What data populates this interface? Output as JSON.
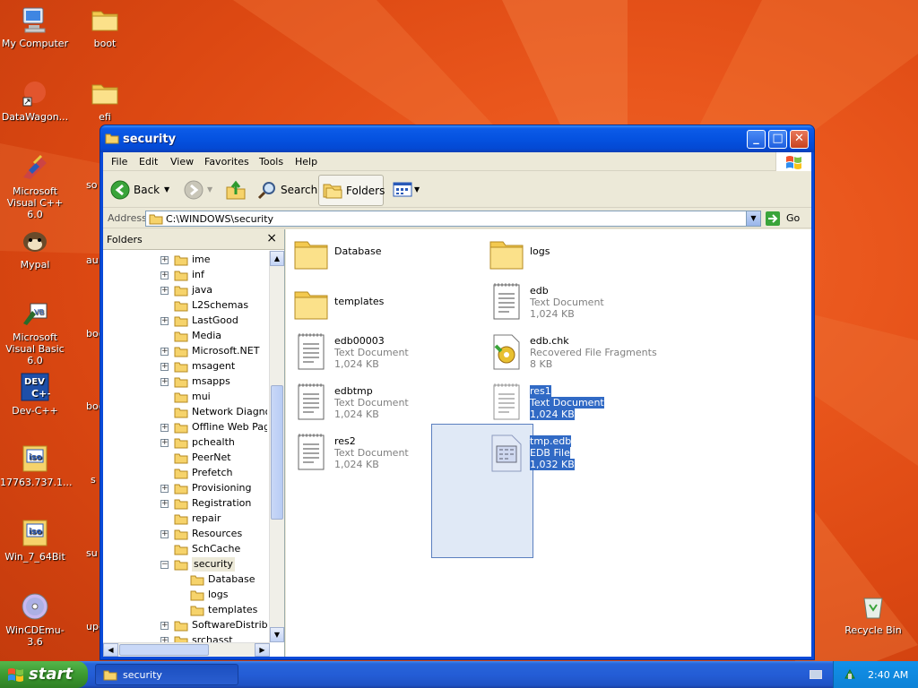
{
  "desktop": {
    "icons": [
      {
        "label": "My Computer",
        "icon": "my-computer-icon"
      },
      {
        "label": "boot",
        "icon": "folder-icon"
      },
      {
        "label": "DataWagon...",
        "icon": "shortcut-icon"
      },
      {
        "label": "efi",
        "icon": "folder-icon"
      },
      {
        "label": "Microsoft Visual C++ 6.0",
        "icon": "visual-cpp-icon"
      },
      {
        "label": "Mypal",
        "icon": "mypal-icon"
      },
      {
        "label": "Microsoft Visual Basic 6.0",
        "icon": "visual-basic-icon"
      },
      {
        "label": "Dev-C++",
        "icon": "dev-cpp-icon"
      },
      {
        "label": "17763.737.1...",
        "icon": "iso-icon"
      },
      {
        "label": "Win_7_64Bit",
        "icon": "iso-icon"
      },
      {
        "label": "WinCDEmu-3.6",
        "icon": "cd-icon"
      },
      {
        "label": "Recycle Bin",
        "icon": "recycle-bin-icon"
      }
    ],
    "partial_labels": [
      "so",
      "au",
      "boo",
      "boot",
      "s",
      "su",
      "upd"
    ]
  },
  "window": {
    "title": "security",
    "menu": [
      "File",
      "Edit",
      "View",
      "Favorites",
      "Tools",
      "Help"
    ],
    "toolbar": {
      "back": "Back",
      "search": "Search",
      "folders": "Folders"
    },
    "address": {
      "label": "Address",
      "value": "C:\\WINDOWS\\security",
      "go": "Go"
    },
    "folders_pane": {
      "title": "Folders",
      "close": "×",
      "items": [
        {
          "label": "ime",
          "expander": "+",
          "level": 0
        },
        {
          "label": "inf",
          "expander": "+",
          "level": 0
        },
        {
          "label": "java",
          "expander": "+",
          "level": 0
        },
        {
          "label": "L2Schemas",
          "expander": "",
          "level": 0
        },
        {
          "label": "LastGood",
          "expander": "+",
          "level": 0
        },
        {
          "label": "Media",
          "expander": "",
          "level": 0
        },
        {
          "label": "Microsoft.NET",
          "expander": "+",
          "level": 0
        },
        {
          "label": "msagent",
          "expander": "+",
          "level": 0
        },
        {
          "label": "msapps",
          "expander": "+",
          "level": 0
        },
        {
          "label": "mui",
          "expander": "",
          "level": 0
        },
        {
          "label": "Network Diagnost",
          "expander": "",
          "level": 0
        },
        {
          "label": "Offline Web Page",
          "expander": "+",
          "level": 0
        },
        {
          "label": "pchealth",
          "expander": "+",
          "level": 0
        },
        {
          "label": "PeerNet",
          "expander": "",
          "level": 0
        },
        {
          "label": "Prefetch",
          "expander": "",
          "level": 0
        },
        {
          "label": "Provisioning",
          "expander": "+",
          "level": 0
        },
        {
          "label": "Registration",
          "expander": "+",
          "level": 0
        },
        {
          "label": "repair",
          "expander": "",
          "level": 0
        },
        {
          "label": "Resources",
          "expander": "+",
          "level": 0
        },
        {
          "label": "SchCache",
          "expander": "",
          "level": 0
        },
        {
          "label": "security",
          "expander": "−",
          "level": 0
        },
        {
          "label": "Database",
          "expander": "",
          "level": 1
        },
        {
          "label": "logs",
          "expander": "",
          "level": 1
        },
        {
          "label": "templates",
          "expander": "",
          "level": 1
        },
        {
          "label": "SoftwareDistribut",
          "expander": "+",
          "level": 0
        },
        {
          "label": "srchasst",
          "expander": "+",
          "level": 0
        }
      ]
    },
    "files": [
      {
        "name": "Database",
        "type": "",
        "size": "",
        "icon": "folder-icon",
        "selected": false
      },
      {
        "name": "logs",
        "type": "",
        "size": "",
        "icon": "folder-icon",
        "selected": false
      },
      {
        "name": "templates",
        "type": "",
        "size": "",
        "icon": "folder-icon",
        "selected": false
      },
      {
        "name": "edb",
        "type": "Text Document",
        "size": "1,024 KB",
        "icon": "text-document-icon",
        "selected": false
      },
      {
        "name": "edb00003",
        "type": "Text Document",
        "size": "1,024 KB",
        "icon": "text-document-icon",
        "selected": false
      },
      {
        "name": "edb.chk",
        "type": "Recovered File Fragments",
        "size": "8 KB",
        "icon": "recovered-fragments-icon",
        "selected": false
      },
      {
        "name": "edbtmp",
        "type": "Text Document",
        "size": "1,024 KB",
        "icon": "text-document-icon",
        "selected": false
      },
      {
        "name": "res1",
        "type": "Text Document",
        "size": "1,024 KB",
        "icon": "text-document-icon",
        "selected": true
      },
      {
        "name": "res2",
        "type": "Text Document",
        "size": "1,024 KB",
        "icon": "text-document-icon",
        "selected": false
      },
      {
        "name": "tmp.edb",
        "type": "EDB File",
        "size": "1,032 KB",
        "icon": "edb-file-icon",
        "selected": true
      }
    ]
  },
  "taskbar": {
    "start": "start",
    "task": "security",
    "clock": "2:40 AM"
  }
}
